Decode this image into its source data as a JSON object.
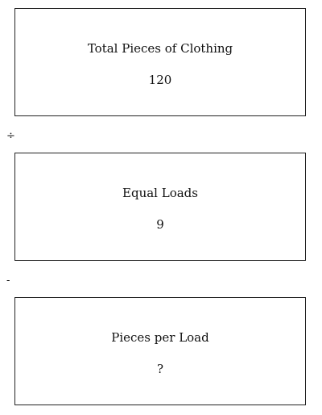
{
  "boxes": [
    {
      "label": "Total Pieces of Clothing",
      "value": "120"
    },
    {
      "label": "Equal Loads",
      "value": "9"
    },
    {
      "label": "Pieces per Load",
      "value": "?"
    }
  ],
  "operators": [
    "÷",
    "-"
  ]
}
